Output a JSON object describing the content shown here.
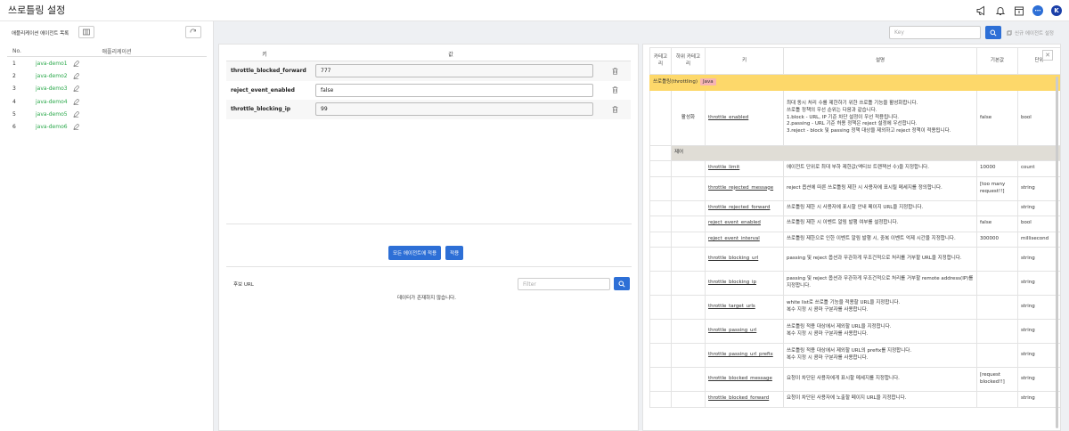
{
  "header": {
    "title": "쓰로틀링 설정",
    "avatar_letter": "K"
  },
  "left": {
    "title": "애플리케이션 에이전트 목록",
    "columns": {
      "no": "No.",
      "app": "애플리케이션"
    },
    "rows": [
      {
        "no": "1",
        "name": "java-demo1"
      },
      {
        "no": "2",
        "name": "java-demo2"
      },
      {
        "no": "3",
        "name": "java-demo3"
      },
      {
        "no": "4",
        "name": "java-demo4"
      },
      {
        "no": "5",
        "name": "java-demo5"
      },
      {
        "no": "6",
        "name": "java-demo6"
      }
    ]
  },
  "middle": {
    "columns": {
      "key": "키",
      "value": "값"
    },
    "rows": [
      {
        "key": "throttle_blocked_forward",
        "value": "777"
      },
      {
        "key": "reject_event_enabled",
        "value": "false"
      },
      {
        "key": "throttle_blocking_ip",
        "value": "99"
      }
    ],
    "apply_all_label": "모든 에이전트에 적용",
    "apply_label": "적용",
    "url_label": "후보 URL",
    "filter_placeholder": "Filter",
    "no_data": "데이터가 존재하지 않습니다."
  },
  "right": {
    "search_placeholder": "Key",
    "new_agent_label": "신규 에이전트 설정",
    "columns": {
      "category": "카테고리",
      "subcategory": "하위 카테고리",
      "key": "키",
      "desc": "설명",
      "default": "기본값",
      "unit": "단위"
    },
    "category": {
      "name": "쓰로틀링(throttling)",
      "tag": "Java"
    },
    "activation": {
      "sub": "활성화",
      "key": "throttle_enabled",
      "desc": "최대 동시 처리 수를 제한하기 위한 쓰로틀 기능을 활성화합니다.\n쓰로틀 정책의 우선 순위는 다음과 같습니다.\n1.block - URL, IP 기준 차단 설정이 우선 적용됩니다.\n2.passing - URL 기준 허용 정책은 reject 설정에 우선합니다.\n3.reject - block 및 passing 정책 대상을 제외하고 reject 정책이 적용됩니다.",
      "default": "false",
      "unit": "bool"
    },
    "control_label": "제어",
    "rows": [
      {
        "key": "throttle_limit",
        "desc": "에이전트 단위로 최대 부하 제한값(액티브 트랜잭션 수)을 지정합니다.",
        "default": "10000",
        "unit": "count"
      },
      {
        "key": "throttle_rejected_message",
        "desc": "reject 옵션에 따른 쓰로틀링 제한 시 사용자에 표시될 메세지를 정의합니다.",
        "default": "[too many request!!]",
        "unit": "string"
      },
      {
        "key": "throttle_rejected_forward",
        "desc": "쓰로틀링 제한 시 사용자에 표시할 안내 페이지 URL을 지정합니다.",
        "default": "",
        "unit": "string"
      },
      {
        "key": "reject_event_enabled",
        "desc": "쓰로틀링 제한 시 이벤트 알림 발행 여부를 설정합니다.",
        "default": "false",
        "unit": "bool"
      },
      {
        "key": "reject_event_interval",
        "desc": "쓰로틀링 제한으로 인한 이벤트 알림 발행 시, 중복 이벤트 억제 시간을 지정합니다.",
        "default": "300000",
        "unit": "millisecond"
      },
      {
        "key": "throttle_blocking_url",
        "desc": "passing 및 reject 옵션과 무관하게 무조건적으로 처리를 거부할 URL을 지정합니다.",
        "default": "",
        "unit": "string"
      },
      {
        "key": "throttle_blocking_ip",
        "desc": "passing 및 reject 옵션과 무관하게 무조건적으로 처리를 거부할 remote address(IP)를 지정합니다.",
        "default": "",
        "unit": "string"
      },
      {
        "key": "throttle_target_urls",
        "desc": "white list로 쓰로틀 기능을 적용할 URL을 지정합니다.\n복수 지정 시 콤마 구분자를 사용합니다.",
        "default": "",
        "unit": "string"
      },
      {
        "key": "throttle_passing_url",
        "desc": "쓰로틀링 적용 대상에서 제외할 URL을 지정합니다.\n복수 지정 시 콤마 구분자를 사용합니다.",
        "default": "",
        "unit": "string"
      },
      {
        "key": "throttle_passing_url_prefix",
        "desc": "쓰로틀링 적용 대상에서 제외할 URL의 prefix를 지정합니다.\n복수 지정 시 콤마 구분자를 사용합니다.",
        "default": "",
        "unit": "string"
      },
      {
        "key": "throttle_blocked_message",
        "desc": "요청이 차단된 사용자에게 표시할 메세지를 지정합니다.",
        "default": "[request blocked!!]",
        "unit": "string"
      },
      {
        "key": "throttle_blocked_forward",
        "desc": "요청이 차단된 사용자에 노출할 페이지 URL을 지정합니다.",
        "default": "",
        "unit": "string"
      }
    ]
  }
}
